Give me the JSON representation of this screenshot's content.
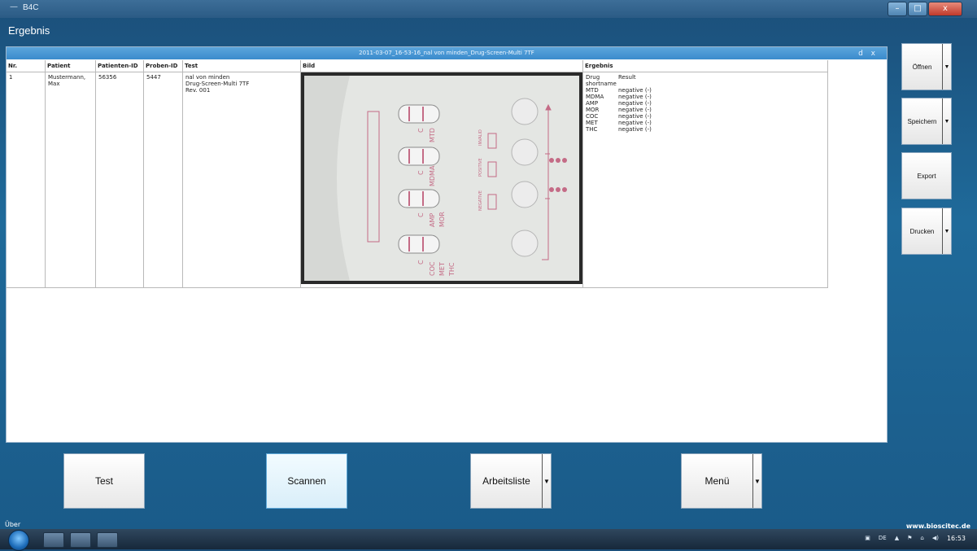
{
  "titlebar": {
    "app_title": "B4C",
    "dash": "—",
    "minimize": "–",
    "maximize": "□",
    "close": "x"
  },
  "window": {
    "caption": "Ergebnis"
  },
  "document": {
    "header": "2011-03-07_16-53-16_nal von minden_Drug-Screen-Multi 7TF",
    "ctrl_restore": "d",
    "ctrl_close": "x"
  },
  "table": {
    "columns": [
      "Nr.",
      "Patient",
      "Patienten-ID",
      "Proben-ID",
      "Test",
      "Bild",
      "Ergebnis"
    ],
    "row": {
      "nr": "1",
      "patient": "Mustermann, Max",
      "patient_id": "56356",
      "proben_id": "5447",
      "test_lines": [
        "nal von minden",
        "Drug-Screen-Multi 7TF",
        "Rev. 001"
      ],
      "results_header": {
        "drug": "Drug shortname",
        "result": "Result"
      },
      "results": [
        {
          "drug": "MTD",
          "result": "negative (-)"
        },
        {
          "drug": "MDMA",
          "result": "negative (-)"
        },
        {
          "drug": "AMP",
          "result": "negative (-)"
        },
        {
          "drug": "MOR",
          "result": "negative (-)"
        },
        {
          "drug": "COC",
          "result": "negative (-)"
        },
        {
          "drug": "MET",
          "result": "negative (-)"
        },
        {
          "drug": "THC",
          "result": "negative (-)"
        }
      ]
    }
  },
  "cassette": {
    "drug_labels": [
      "MTD",
      "MDMA",
      "AMP",
      "MOR",
      "COC",
      "MET",
      "THC"
    ],
    "control_label": "C",
    "legend": [
      "NEGATIVE",
      "POSITIVE",
      "INVALID"
    ]
  },
  "side_buttons": {
    "open": "Öffnen",
    "save": "Speichern",
    "export": "Export",
    "print": "Drucken"
  },
  "bottom_buttons": {
    "test": "Test",
    "scan": "Scannen",
    "worklist": "Arbeitsliste",
    "menu": "Menü"
  },
  "status": {
    "left": "Über",
    "right": "www.bioscitec.de"
  },
  "taskbar": {
    "lang": "DE",
    "time": "16:53"
  }
}
